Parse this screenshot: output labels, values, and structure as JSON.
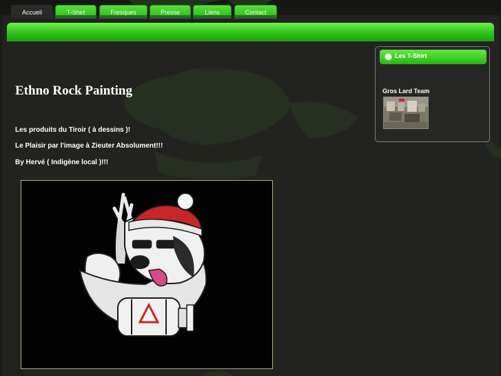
{
  "nav": {
    "tabs": [
      {
        "label": "Accueil",
        "active": true
      },
      {
        "label": "T-Shirt",
        "active": false
      },
      {
        "label": "Fresques",
        "active": false
      },
      {
        "label": "Presse",
        "active": false
      },
      {
        "label": "Liens",
        "active": false
      },
      {
        "label": "Contact",
        "active": false
      }
    ]
  },
  "main": {
    "title": "Ethno Rock Painting",
    "lines": [
      "Les produits du Tiroir ( à dessins )!",
      "Le Plaisir par l'image à Zieuter Absolument!!!",
      "By Hervé ( Indigène local )!!!"
    ],
    "image_icon": "dog-mascot-tshirt-illustration"
  },
  "sidebar": {
    "title": "Les T-Shirt",
    "album_title": "Gros Lard Team",
    "album_caption": "",
    "thumb_icon": "photo-thumbnail"
  },
  "colors": {
    "nav_green": "#2fc21a",
    "background": "#1b1c1a",
    "frame_border": "#b6a97e"
  }
}
